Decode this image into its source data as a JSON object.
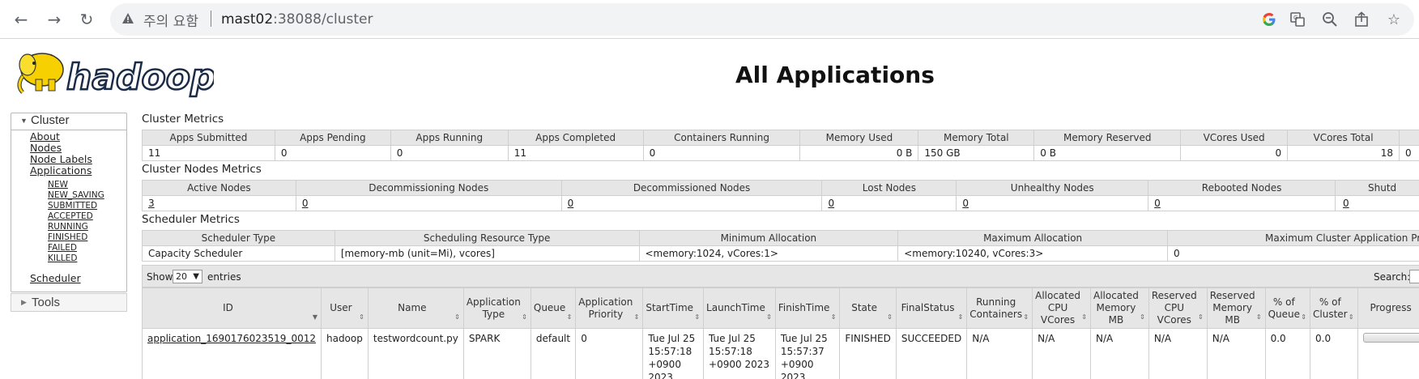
{
  "browser": {
    "security_label": "주의 요함",
    "url_host": "mast02",
    "url_rest": ":38088/cluster"
  },
  "header": {
    "logo_text": "hadoop",
    "title": "All Applications"
  },
  "nav": {
    "cluster_label": "Cluster",
    "links": [
      "About",
      "Nodes",
      "Node Labels",
      "Applications"
    ],
    "app_states": [
      "NEW",
      "NEW_SAVING",
      "SUBMITTED",
      "ACCEPTED",
      "RUNNING",
      "FINISHED",
      "FAILED",
      "KILLED"
    ],
    "scheduler": "Scheduler",
    "tools_label": "Tools"
  },
  "cluster_metrics": {
    "title": "Cluster Metrics",
    "headers": [
      "Apps Submitted",
      "Apps Pending",
      "Apps Running",
      "Apps Completed",
      "Containers Running",
      "Memory Used",
      "Memory Total",
      "Memory Reserved",
      "VCores Used",
      "VCores Total"
    ],
    "values": [
      "11",
      "0",
      "0",
      "11",
      "0",
      "0 B",
      "150 GB",
      "0 B",
      "0",
      "18",
      "0"
    ]
  },
  "node_metrics": {
    "title": "Cluster Nodes Metrics",
    "headers": [
      "Active Nodes",
      "Decommissioning Nodes",
      "Decommissioned Nodes",
      "Lost Nodes",
      "Unhealthy Nodes",
      "Rebooted Nodes",
      "Shutd"
    ],
    "values": [
      "3",
      "0",
      "0",
      "0",
      "0",
      "0",
      "0"
    ]
  },
  "scheduler_metrics": {
    "title": "Scheduler Metrics",
    "headers": [
      "Scheduler Type",
      "Scheduling Resource Type",
      "Minimum Allocation",
      "Maximum Allocation",
      "Maximum Cluster Application Prio"
    ],
    "values": [
      "Capacity Scheduler",
      "[memory-mb (unit=Mi), vcores]",
      "<memory:1024, vCores:1>",
      "<memory:10240, vCores:3>",
      "0"
    ]
  },
  "apps": {
    "show_label": "Show",
    "page_size": "20",
    "entries_label": "entries",
    "search_label": "Search:",
    "columns": [
      "ID",
      "User",
      "Name",
      "Application Type",
      "Queue",
      "Application Priority",
      "StartTime",
      "LaunchTime",
      "FinishTime",
      "State",
      "FinalStatus",
      "Running Containers",
      "Allocated CPU VCores",
      "Allocated Memory MB",
      "Reserved CPU VCores",
      "Reserved Memory MB",
      "% of Queue",
      "% of Cluster",
      "Progress"
    ],
    "rows": [
      {
        "id": "application_1690176023519_0012",
        "user": "hadoop",
        "name": "testwordcount.py",
        "type": "SPARK",
        "queue": "default",
        "priority": "0",
        "start": "Tue Jul 25 15:57:18 +0900 2023",
        "launch": "Tue Jul 25 15:57:18 +0900 2023",
        "finish": "Tue Jul 25 15:57:37 +0900 2023",
        "state": "FINISHED",
        "final_status": "SUCCEEDED",
        "running_containers": "N/A",
        "alloc_vcores": "N/A",
        "alloc_mem": "N/A",
        "res_vcores": "N/A",
        "res_mem": "N/A",
        "pct_queue": "0.0",
        "pct_cluster": "0.0",
        "progress": 1.0
      }
    ]
  }
}
